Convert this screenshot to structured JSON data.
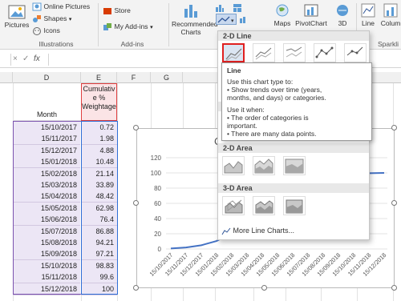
{
  "ribbon": {
    "pictures_label": "Pictures",
    "online_pictures_label": "Online Pictures",
    "shapes_label": "Shapes",
    "icons_label": "Icons",
    "illustrations_group": "Illustrations",
    "store_label": "Store",
    "my_addins_label": "My Add-ins",
    "addins_group": "Add-ins",
    "recommended_charts_line1": "Recommended",
    "recommended_charts_line2": "Charts",
    "maps_label": "Maps",
    "pivotchart_label": "PivotChart",
    "threed_label": "3D",
    "line_label": "Line",
    "column_label": "Colum",
    "sparklines_group": "Sparkli"
  },
  "formula_bar": {
    "fx": "fx",
    "cancel": "×",
    "enter": "✓"
  },
  "columns": [
    "D",
    "E",
    "F",
    "G"
  ],
  "header_cells": {
    "month": "Month",
    "cumulative": "Cumulative % Weightage"
  },
  "rows": [
    {
      "month": "15/10/2017",
      "value": "0.72"
    },
    {
      "month": "15/11/2017",
      "value": "1.98"
    },
    {
      "month": "15/12/2017",
      "value": "4.88"
    },
    {
      "month": "15/01/2018",
      "value": "10.48"
    },
    {
      "month": "15/02/2018",
      "value": "21.14"
    },
    {
      "month": "15/03/2018",
      "value": "33.89"
    },
    {
      "month": "15/04/2018",
      "value": "48.42"
    },
    {
      "month": "15/05/2018",
      "value": "62.98"
    },
    {
      "month": "15/06/2018",
      "value": "76.4"
    },
    {
      "month": "15/07/2018",
      "value": "86.88"
    },
    {
      "month": "15/08/2018",
      "value": "94.21"
    },
    {
      "month": "15/09/2018",
      "value": "97.21"
    },
    {
      "month": "15/10/2018",
      "value": "98.83"
    },
    {
      "month": "15/11/2018",
      "value": "99.6"
    },
    {
      "month": "15/12/2018",
      "value": "100"
    }
  ],
  "chart": {
    "title_fragment": "C",
    "y_ticks": [
      "120",
      "100",
      "80",
      "60",
      "40",
      "20",
      "0"
    ],
    "x_labels": [
      "15/10/2017",
      "15/11/2017",
      "15/12/2017",
      "15/01/2018",
      "15/02/2018",
      "15/03/2018",
      "15/04/2018",
      "15/05/2018",
      "15/06/2018",
      "15/07/2018",
      "15/08/2018",
      "15/09/2018",
      "15/10/2018",
      "15/11/2018",
      "15/12/2018"
    ],
    "line_color": "#4472c4"
  },
  "dropdown": {
    "section_2d_line": "2-D Line",
    "section_3d_line": "3",
    "section_2d_area": "2-D Area",
    "section_3d_area": "3-D Area",
    "more_label": "More Line Charts...",
    "selected_color": "#e02020"
  },
  "tooltip": {
    "title": "Line",
    "line1": "Use this chart type to:",
    "line2": "• Show trends over time (years,",
    "line3": "months, and days) or categories.",
    "line4": "Use it when:",
    "line5": "• The order of categories is",
    "line6": "important.",
    "line7": "• There are many data points."
  }
}
